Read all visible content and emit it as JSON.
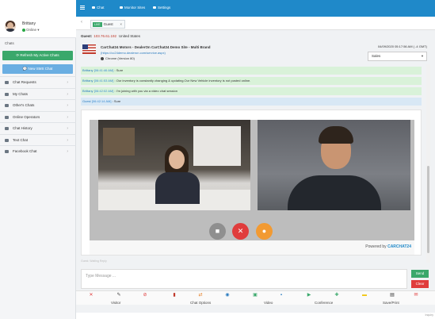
{
  "profile": {
    "name": "Brittany",
    "status": "Online"
  },
  "sidebar": {
    "section": "Chats",
    "refresh_button": "Refresh My Active Chats",
    "new_sms_button": "New SMS Chat",
    "items": [
      {
        "label": "Chat Requests"
      },
      {
        "label": "My Chats"
      },
      {
        "label": "Other's Chats"
      },
      {
        "label": "Online Operators"
      },
      {
        "label": "Chat History"
      },
      {
        "label": "Text Chat"
      },
      {
        "label": "Facebook Chat"
      }
    ]
  },
  "topbar": {
    "chat": "Chat",
    "monitor": "Monitor Sites",
    "settings": "Settings"
  },
  "tab": {
    "badge": "LIVE",
    "label": "Guest",
    "close": "×"
  },
  "visitor": {
    "guest_label": "Guest:",
    "ip": "103.76.61.192",
    "country": "United States",
    "site": "CarChat24 Motors - DealerOn CarChat24 Demo Site - Multi Brand",
    "url": "(https://cc24demo.dealeron.com/service.aspx)",
    "browser": "Chrome (Version 80)",
    "datetime": "04/09/2020 05:17:56 AM ( -4 GMT)",
    "department": "Sales"
  },
  "messages": [
    {
      "who": "Brittany",
      "time": "[06:41:46 AM]",
      "text": "Sure",
      "kind": "agent"
    },
    {
      "who": "Brittany",
      "time": "[06:41:53 AM]",
      "text": "Our inventory is constantly changing & updating.Our New Vehicle inventory is not posted online.",
      "kind": "agent"
    },
    {
      "who": "Brittany",
      "time": "[06:42:02 AM]",
      "text": "I'm joining with you via a video chat session",
      "kind": "agent"
    },
    {
      "who": "Guest",
      "time": "[06:42:14 AM]",
      "text": "Sure",
      "kind": "guest"
    }
  ],
  "video": {
    "powered_by": "Powered by",
    "brand": "CARCHAT24"
  },
  "compose": {
    "label": "Guest: Waiting Reply",
    "placeholder": "Type Message ...",
    "send": "Send",
    "clear": "Clear"
  },
  "toolbar": {
    "visitor": "Visitor",
    "chat_options": "Chat Options",
    "video": "Video",
    "conference": "Conference",
    "save_print": "Save/Print"
  },
  "footer": {
    "text": "Inquiry"
  },
  "colors": {
    "accent": "#1f89c9",
    "green": "#3aa86b",
    "red": "#e03c3c",
    "orange": "#f29a32"
  }
}
